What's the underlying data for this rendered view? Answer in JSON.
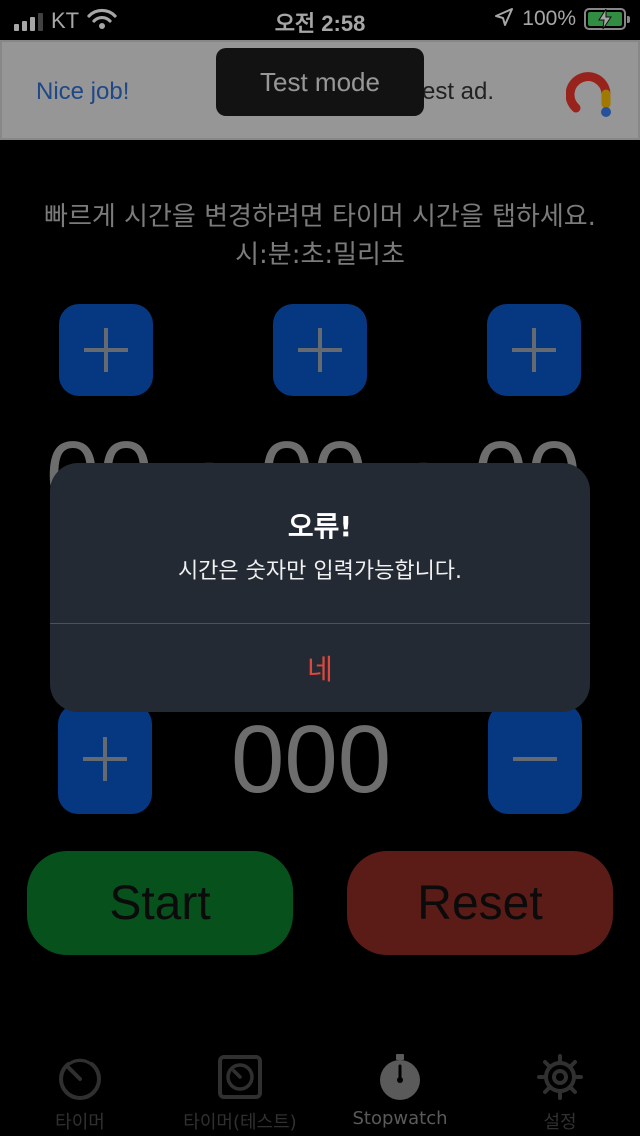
{
  "status_bar": {
    "carrier": "KT",
    "time": "오전 2:58",
    "battery": "100%"
  },
  "ad": {
    "nice_job": "Nice job!",
    "ad_text": "est ad.",
    "test_mode": "Test mode"
  },
  "main": {
    "instruction_line1": "빠르게 시간을 변경하려면 타이머 시간을 탭하세요.",
    "instruction_line2": "시:분:초:밀리초",
    "hours": "00",
    "minutes": "00",
    "seconds": "00",
    "milliseconds": "000",
    "colon": ":"
  },
  "buttons": {
    "start": "Start",
    "reset": "Reset"
  },
  "tabs": [
    {
      "label": "타이머",
      "icon": "timer-icon"
    },
    {
      "label": "타이머(테스트)",
      "icon": "timer-test-icon"
    },
    {
      "label": "Stopwatch",
      "icon": "stopwatch-icon"
    },
    {
      "label": "설정",
      "icon": "gear-icon"
    }
  ],
  "alert": {
    "title": "오류!",
    "message": "시간은 숫자만 입력가능합니다.",
    "confirm": "네"
  },
  "colors": {
    "accent_blue": "#0a56c8",
    "start_green": "#0b7d2d",
    "reset_red": "#8d2a22",
    "alert_button": "#e0463c"
  }
}
